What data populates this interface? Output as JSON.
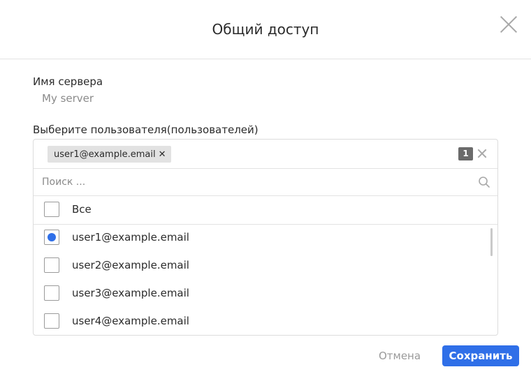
{
  "dialog": {
    "title": "Общий доступ"
  },
  "server": {
    "label": "Имя сервера",
    "value": "My server"
  },
  "users": {
    "label": "Выберите пользователя(пользователей)",
    "selected_tag": "user1@example.email",
    "selected_count": "1",
    "search_placeholder": "Поиск ...",
    "all_label": "Все",
    "items": [
      {
        "label": "user1@example.email",
        "checked": true
      },
      {
        "label": "user2@example.email",
        "checked": false
      },
      {
        "label": "user3@example.email",
        "checked": false
      },
      {
        "label": "user4@example.email",
        "checked": false
      }
    ]
  },
  "footer": {
    "cancel_label": "Отмена",
    "save_label": "Сохранить"
  },
  "colors": {
    "accent": "#2f6fe8",
    "badge": "#6b6b6b",
    "tag_bg": "#e2e2e2"
  },
  "icons": {
    "close": "close-icon",
    "search": "search-icon",
    "tag_remove": "tag-remove-icon",
    "clear": "clear-icon"
  }
}
